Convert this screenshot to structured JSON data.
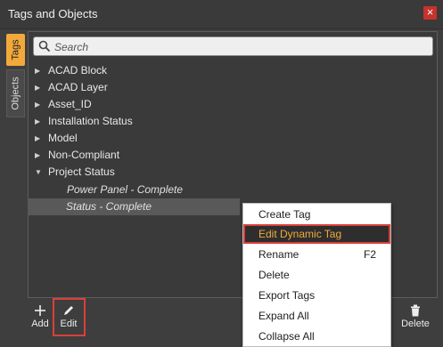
{
  "window": {
    "title": "Tags and Objects",
    "close_glyph": "×"
  },
  "side_tabs": [
    {
      "label": "Tags",
      "active": true
    },
    {
      "label": "Objects",
      "active": false
    }
  ],
  "search": {
    "placeholder": "Search",
    "value": ""
  },
  "tree": {
    "items": [
      {
        "label": "ACAD Block",
        "expanded": false
      },
      {
        "label": "ACAD Layer",
        "expanded": false
      },
      {
        "label": "Asset_ID",
        "expanded": false
      },
      {
        "label": "Installation Status",
        "expanded": false
      },
      {
        "label": "Model",
        "expanded": false
      },
      {
        "label": "Non-Compliant",
        "expanded": false
      },
      {
        "label": "Project Status",
        "expanded": true
      }
    ],
    "children": [
      {
        "label": "Power Panel - Complete",
        "selected": false
      },
      {
        "label": "Status - Complete",
        "selected": true
      }
    ]
  },
  "toolbar": {
    "add_label": "Add",
    "edit_label": "Edit",
    "delete_label": "Delete"
  },
  "context_menu": {
    "items": [
      {
        "label": "Create Tag",
        "shortcut": ""
      },
      {
        "label": "Edit Dynamic Tag",
        "shortcut": "",
        "highlighted": true
      },
      {
        "label": "Rename",
        "shortcut": "F2"
      },
      {
        "label": "Delete",
        "shortcut": ""
      },
      {
        "label": "Export Tags",
        "shortcut": ""
      },
      {
        "label": "Expand All",
        "shortcut": ""
      },
      {
        "label": "Collapse All",
        "shortcut": ""
      }
    ]
  },
  "colors": {
    "accent": "#f2a93b",
    "highlight_border": "#d9403a",
    "close_button": "#c6332c"
  }
}
